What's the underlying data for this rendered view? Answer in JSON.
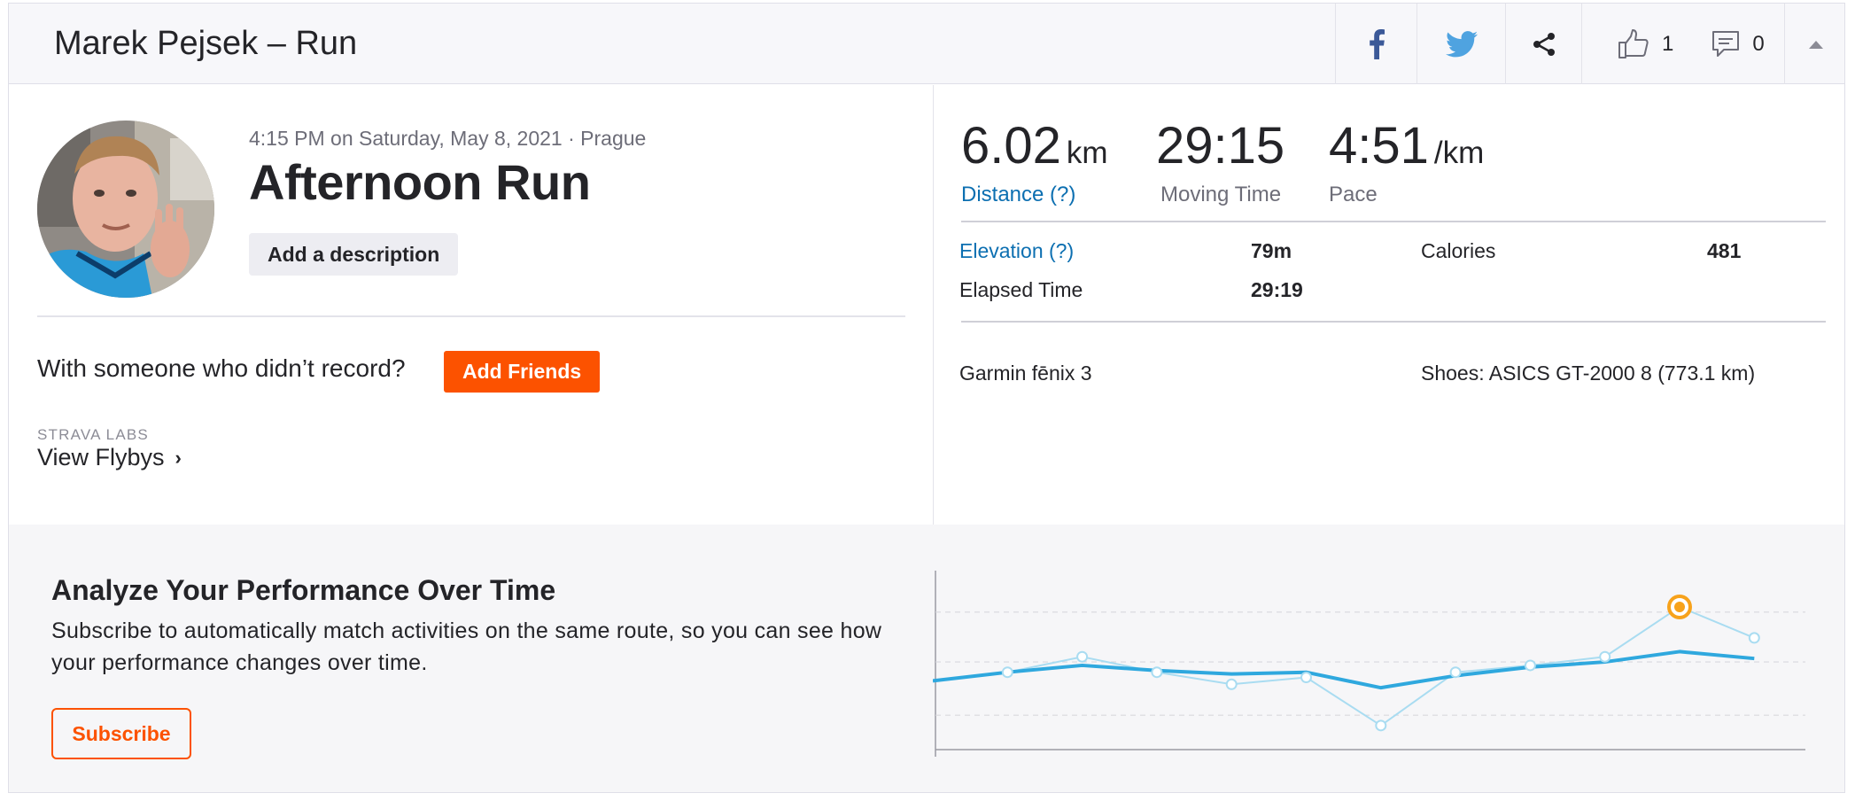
{
  "header": {
    "title": "Marek Pejsek – Run",
    "kudos_count": "1",
    "comments_count": "0",
    "icons": [
      "facebook-icon",
      "twitter-icon",
      "share-icon",
      "thumbs-up-icon",
      "comment-icon",
      "collapse-arrow-icon"
    ]
  },
  "activity": {
    "meta": "4:15 PM on Saturday, May 8, 2021 · Prague",
    "title": "Afternoon Run",
    "add_description_label": "Add a description",
    "with_someone_text": "With someone who didn’t record?",
    "add_friends_label": "Add Friends",
    "labs_label": "STRAVA LABS",
    "flybys_label": "View Flybys",
    "flybys_chevron": "›"
  },
  "stats": {
    "distance": {
      "value": "6.02",
      "unit": "km",
      "label": "Distance (?)"
    },
    "moving_time": {
      "value": "29:15",
      "label": "Moving Time"
    },
    "pace": {
      "value": "4:51",
      "unit": "/km",
      "label": "Pace"
    },
    "elevation": {
      "label": "Elevation (?)",
      "value": "79m"
    },
    "calories": {
      "label": "Calories",
      "value": "481"
    },
    "elapsed_time": {
      "label": "Elapsed Time",
      "value": "29:19"
    },
    "device": "Garmin fēnix 3",
    "shoes": "Shoes: ASICS GT-2000 8 (773.1 km)"
  },
  "promo": {
    "title": "Analyze Your Performance Over Time",
    "text": "Subscribe to automatically match activities on the same route, so you can see how your performance changes over time.",
    "subscribe_label": "Subscribe"
  },
  "colors": {
    "brand_orange": "#fc5200",
    "link_blue": "#0c6fb1",
    "trend_line": "#2fa8de",
    "points_line": "#a9dcf1",
    "highlight": "#f7a21b"
  },
  "chart_data": {
    "type": "line",
    "title": "",
    "xlabel": "",
    "ylabel": "",
    "grid": true,
    "series": [
      {
        "values": [
          0.4,
          0.45,
          0.49,
          0.46,
          0.44,
          0.45,
          0.36,
          0.43,
          0.48,
          0.51,
          0.57,
          0.53
        ]
      },
      {
        "values": [
          null,
          0.45,
          0.54,
          0.45,
          0.38,
          0.42,
          0.14,
          0.45,
          0.49,
          0.54,
          0.83,
          0.65
        ]
      }
    ],
    "ylim": [
      0,
      1
    ],
    "highlight_index": 10
  }
}
